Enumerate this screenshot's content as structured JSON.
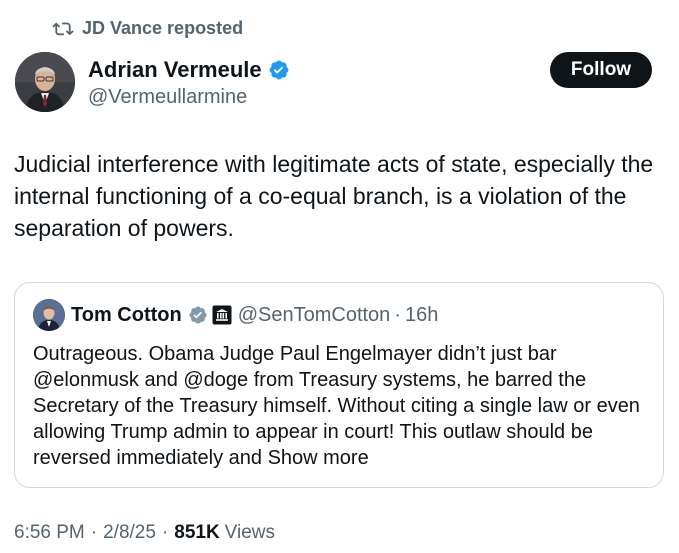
{
  "repost": {
    "text": "JD Vance reposted"
  },
  "author": {
    "name": "Adrian Vermeule",
    "handle": "@Vermeullarmine"
  },
  "follow_label": "Follow",
  "post_text": "Judicial interference with legitimate acts of state, especially the internal functioning of a co-equal branch, is a violation of the separation of powers.",
  "quote": {
    "name": "Tom Cotton",
    "handle": "@SenTomCotton",
    "sep": "·",
    "time": "16h",
    "text": "Outrageous. Obama Judge Paul Engelmayer didn’t just bar @elonmusk and @doge from Treasury systems, he barred the Secretary of the Treasury himself. Without citing a single law or even allowing Trump admin to appear in court! This outlaw should be reversed immediately and",
    "show_more": "Show more"
  },
  "meta": {
    "time": "6:56 PM",
    "sep": "·",
    "date": "2/8/25",
    "views_count": "851K",
    "views_label": "Views"
  },
  "colors": {
    "verified": "#1d9bf0",
    "muted": "#536471",
    "text": "#0f1419",
    "border": "#cfd9de",
    "button": "#0f1419"
  },
  "icons": {
    "repost": "repost-icon",
    "verified": "verified-badge-icon",
    "government": "government-badge-icon"
  }
}
